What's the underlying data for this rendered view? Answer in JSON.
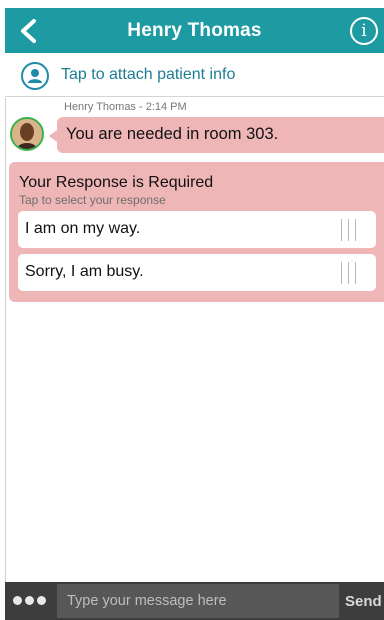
{
  "header": {
    "title": "Henry Thomas",
    "back_icon": "chevron-left-icon",
    "info_icon": "info-icon",
    "info_glyph": "i",
    "color": "#1e9aa3"
  },
  "attach": {
    "label": "Tap to attach patient info",
    "icon": "user-circle-icon",
    "color": "#1e7d94"
  },
  "message": {
    "sender_time": "Henry Thomas - 2:14 PM",
    "text": "You are needed in room 303.",
    "bubble_color": "#eeb6b6"
  },
  "response": {
    "title": "Your Response is Required",
    "subtitle": "Tap to select your response",
    "options": [
      {
        "label": "I am on my way."
      },
      {
        "label": "Sorry, I am busy."
      }
    ]
  },
  "input_bar": {
    "placeholder": "Type your message here",
    "send_label": "Send",
    "more_icon": "more-dots-icon"
  }
}
